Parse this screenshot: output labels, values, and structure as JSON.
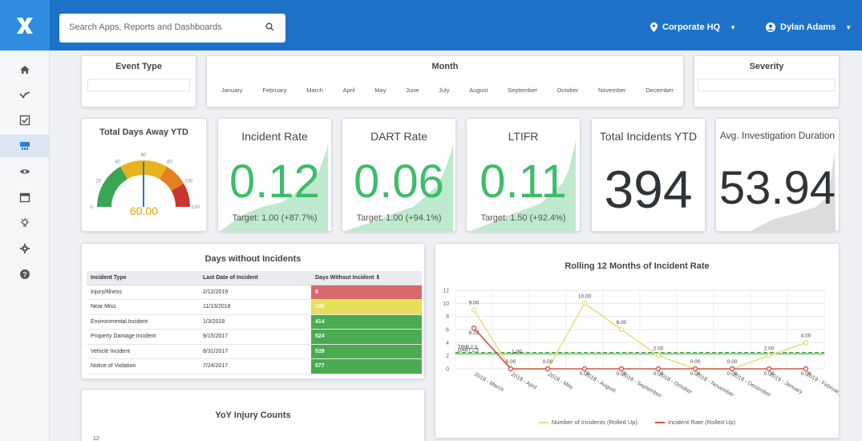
{
  "header": {
    "search_placeholder": "Search Apps, Reports and Dashboards",
    "location": "Corporate HQ",
    "user": "Dylan Adams"
  },
  "sidebar": {
    "items": [
      {
        "icon": "home-icon"
      },
      {
        "icon": "trend-icon"
      },
      {
        "icon": "checklist-icon"
      },
      {
        "icon": "dashboard-icon"
      },
      {
        "icon": "eye-icon"
      },
      {
        "icon": "calendar-icon"
      },
      {
        "icon": "lightbulb-icon"
      },
      {
        "icon": "gear-icon"
      },
      {
        "icon": "help-icon"
      }
    ]
  },
  "filters": {
    "event_type": "Event Type",
    "month": "Month",
    "severity": "Severity",
    "months": [
      "January",
      "February",
      "March",
      "April",
      "May",
      "June",
      "July",
      "August",
      "September",
      "October",
      "November",
      "December"
    ]
  },
  "kpis": {
    "days_away": {
      "title": "Total Days Away YTD",
      "value": "60.00",
      "gauge_min": 0,
      "gauge_max": 120,
      "ticks": [
        "0",
        "20",
        "40",
        "60",
        "80",
        "100",
        "120"
      ]
    },
    "incident_rate": {
      "title": "Incident Rate",
      "value": "0.12",
      "target": "Target: 1.00 (+87.7%)"
    },
    "dart_rate": {
      "title": "DART Rate",
      "value": "0.06",
      "target": "Target: 1.00 (+94.1%)"
    },
    "ltifr": {
      "title": "LTIFR",
      "value": "0.11",
      "target": "Target: 1.50 (+92.4%)"
    },
    "total_incidents": {
      "title": "Total Incidents YTD",
      "value": "394"
    },
    "avg_investigation": {
      "title": "Avg. Investigation Duration",
      "value": "53.94"
    }
  },
  "days_without": {
    "title": "Days without Incidents",
    "headers": [
      "Incident Type",
      "Last Date of Incident",
      "Days Without Incident ⇕"
    ],
    "rows": [
      {
        "type": "Injury/Illness",
        "date": "2/12/2019",
        "days": "8",
        "color": "#d9696a"
      },
      {
        "type": "Near Miss",
        "date": "11/13/2018",
        "days": "100",
        "color": "#e6df58"
      },
      {
        "type": "Environmental Incident",
        "date": "1/3/2018",
        "days": "414",
        "color": "#4aab50"
      },
      {
        "type": "Property Damage Incident",
        "date": "9/15/2017",
        "days": "524",
        "color": "#4aab50"
      },
      {
        "type": "Vehicle Incident",
        "date": "8/31/2017",
        "days": "539",
        "color": "#4aab50"
      },
      {
        "type": "Notice of Violation",
        "date": "7/24/2017",
        "days": "577",
        "color": "#4aab50"
      }
    ]
  },
  "yoy": {
    "title": "YoY Injury Counts",
    "first_tick": "12"
  },
  "chart_data": {
    "type": "line",
    "title": "Rolling 12 Months of Incident Rate",
    "categories": [
      "2018 - March",
      "2018 - April",
      "2018 - May",
      "2018 - August",
      "2018 - September",
      "2018 - October",
      "2018 - November",
      "2018 - December",
      "2019 - January",
      "2019 - February"
    ],
    "ylim": [
      0,
      12
    ],
    "yticks": [
      0,
      2,
      4,
      6,
      8,
      10,
      12
    ],
    "series": [
      {
        "name": "Number of Incidents (Rolled Up)",
        "color": "#e8e07a",
        "values": [
          9,
          0,
          0,
          10,
          6,
          2,
          0,
          0,
          2,
          4
        ],
        "labels": [
          "9.00",
          "0.00",
          "0.00",
          "10.00",
          "6.00",
          "2.00",
          "0.00",
          "0.00",
          "2.00",
          "4.00"
        ]
      },
      {
        "name": "Incident Rate (Rolled Up)",
        "color": "#d9534f",
        "values": [
          6.22,
          0,
          0,
          0,
          0,
          0,
          0,
          0,
          0,
          0
        ],
        "labels": [
          "6.22",
          "",
          "",
          "0.00",
          "0.00",
          "0.00",
          "0.00",
          "0.00",
          "0.00",
          "0.00"
        ]
      }
    ],
    "reference_lines": [
      {
        "name": "DART 2.5",
        "value": 2.5,
        "color": "#3a9a3a"
      },
      {
        "name": "TRIR 2.3",
        "value": 2.3,
        "color": "#55aa55"
      }
    ],
    "annotation": "1.00"
  }
}
